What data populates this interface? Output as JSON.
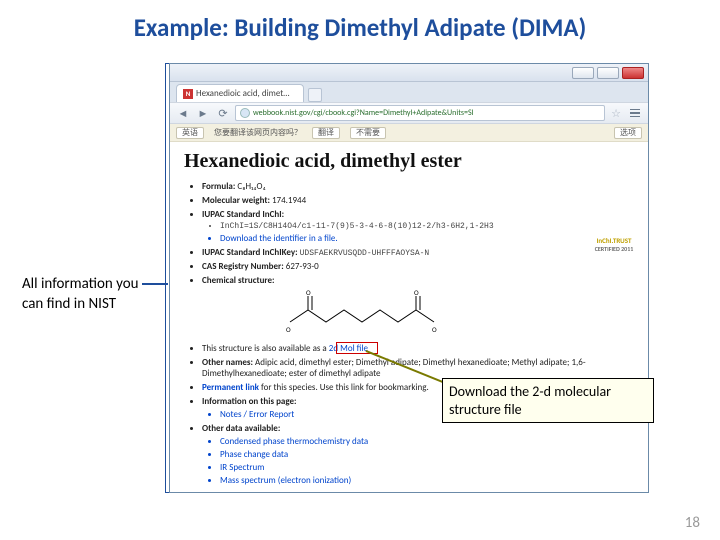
{
  "title": "Example: Building Dimethyl Adipate (DIMA)",
  "left_annotation": "All information you can find in NIST",
  "browser": {
    "tab_title": "Hexanedioic acid, dimet…",
    "url": "webbook.nist.gov/cgi/cbook.cgi?Name=Dimethyl+Adipate&Units=SI",
    "translate_prompt": "您要翻译该网页内容吗？",
    "translate_action": "翻译",
    "translate_decline": "不需要",
    "translate_options": "选项"
  },
  "page": {
    "heading": "Hexanedioic acid, dimethyl ester",
    "formula_label": "Formula:",
    "formula_value": "C₈H₁₄O₄",
    "mw_label": "Molecular weight:",
    "mw_value": "174.1944",
    "inchi_label": "IUPAC Standard InChI:",
    "inchi_string": "InChI=1S/C8H14O4/c1-11-7(9)5-3-4-6-8(10)12-2/h3-6H2,1-2H3",
    "inchi_download": "Download the identifier in a file.",
    "inchikey_label": "IUPAC Standard InChIKey:",
    "inchikey_value": "UDSFAEKRVUSQDD-UHFFFAOYSA-N",
    "cas_label": "CAS Registry Number:",
    "cas_value": "627-93-0",
    "chemstruct_label": "Chemical structure:",
    "struct_avail": "This structure is also available as a",
    "molfile_link": "2d Mol file",
    "other_names_label": "Other names:",
    "other_names_value": "Adipic acid, dimethyl ester; Dimethyl adipate; Dimethyl hexanedioate; Methyl adipate; 1,6-Dimethylhexanedioate; ester of dimethyl adipate",
    "permalink_label": "Permanent link",
    "permalink_rest": " for this species. Use this link for bookmarking.",
    "info_label": "Information on this page:",
    "info_notes": "Notes / Error Report",
    "other_data_label": "Other data available:",
    "other_items": [
      "Condensed phase thermochemistry data",
      "Phase change data",
      "IR Spectrum",
      "Mass spectrum (electron ionization)"
    ],
    "badge_top": "InChI.TRUST",
    "badge_bot": "CERTIFIED 2011"
  },
  "callout": "Download the 2-d molecular structure file",
  "page_number": "18"
}
